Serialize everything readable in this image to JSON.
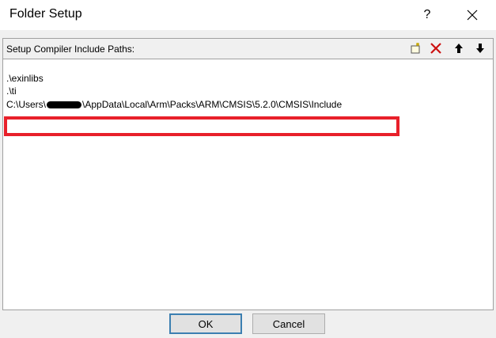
{
  "window": {
    "title": "Folder Setup",
    "help_label": "?"
  },
  "group": {
    "label": "Setup Compiler Include Paths:",
    "toolbar": [
      "new-folder-icon",
      "delete-icon",
      "move-up-icon",
      "move-down-icon"
    ]
  },
  "paths": {
    "item1": ".\\exinlibs",
    "item2": ".\\ti",
    "item3_prefix": "C:\\Users\\",
    "item3_suffix": "\\AppData\\Local\\Arm\\Packs\\ARM\\CMSIS\\5.2.0\\CMSIS\\Include"
  },
  "buttons": {
    "ok": "OK",
    "cancel": "Cancel"
  },
  "colors": {
    "highlight": "#e8202a",
    "delete_icon": "#cc1111",
    "default_button_border": "#3c7fb1"
  }
}
